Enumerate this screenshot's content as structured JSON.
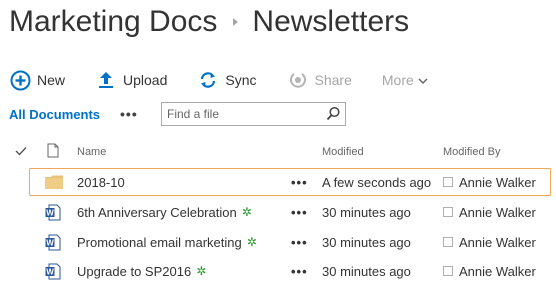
{
  "breadcrumb": {
    "site": "Marketing Docs",
    "library": "Newsletters"
  },
  "toolbar": {
    "new_label": "New",
    "upload_label": "Upload",
    "sync_label": "Sync",
    "share_label": "Share",
    "more_label": "More"
  },
  "view": {
    "current": "All Documents",
    "more": "•••"
  },
  "search": {
    "placeholder": "Find a file",
    "value": ""
  },
  "columns": {
    "name": "Name",
    "modified": "Modified",
    "modified_by": "Modified By"
  },
  "rows": [
    {
      "type": "folder",
      "name": "2018-10",
      "modified": "A few seconds ago",
      "modified_by": "Annie Walker",
      "is_new": false,
      "selected": true
    },
    {
      "type": "doc",
      "name": "6th Anniversary Celebration",
      "modified": "30 minutes ago",
      "modified_by": "Annie Walker",
      "is_new": true,
      "selected": false
    },
    {
      "type": "doc",
      "name": "Promotional email marketing",
      "modified": "30 minutes ago",
      "modified_by": "Annie Walker",
      "is_new": true,
      "selected": false
    },
    {
      "type": "doc",
      "name": "Upgrade to SP2016",
      "modified": "30 minutes ago",
      "modified_by": "Annie Walker",
      "is_new": true,
      "selected": false
    }
  ],
  "row_menu": "•••",
  "new_badge": "✲",
  "colors": {
    "accent": "#0072c6",
    "selection_border": "#f0a85c",
    "folder": "#e8c27a",
    "word": "#2b579a",
    "new_badge": "#2e9a2e",
    "disabled": "#a6a6a6"
  },
  "icons": {
    "new": "plus-circle-icon",
    "upload": "upload-arrow-icon",
    "sync": "sync-icon",
    "share": "share-icon",
    "more": "chevron-down-icon",
    "search": "search-icon",
    "select_all": "checkmark-icon",
    "type_header": "document-icon",
    "folder": "folder-icon",
    "word": "word-document-icon"
  }
}
